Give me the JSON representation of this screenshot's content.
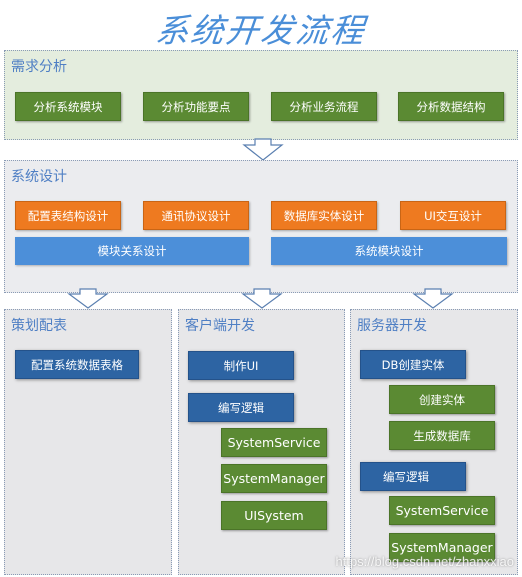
{
  "title": "系统开发流程",
  "requirements": {
    "label": "需求分析",
    "items": [
      "分析系统模块",
      "分析功能要点",
      "分析业务流程",
      "分析数据结构"
    ]
  },
  "design": {
    "label": "系统设计",
    "orange_items": [
      "配置表结构设计",
      "通讯协议设计",
      "数据库实体设计",
      "UI交互设计"
    ],
    "blue_items": [
      "模块关系设计",
      "系统模块设计"
    ]
  },
  "planning": {
    "label": "策划配表",
    "items": [
      "配置系统数据表格"
    ]
  },
  "client": {
    "label": "客户端开发",
    "steps": [
      "制作UI",
      "编写逻辑"
    ],
    "sub_items": [
      "SystemService",
      "SystemManager",
      "UISystem"
    ]
  },
  "server": {
    "label": "服务器开发",
    "db_step": "DB创建实体",
    "db_sub_items": [
      "创建实体",
      "生成数据库"
    ],
    "logic_step": "编写逻辑",
    "logic_sub_items": [
      "SystemService",
      "SystemManager"
    ]
  },
  "watermark": "https://blog.csdn.net/zhanxxiao",
  "colors": {
    "title": "#4a8ed8",
    "green_box": "#5b8a33",
    "orange_box": "#ee7a20",
    "light_blue_box": "#4c8fd9",
    "navy_box": "#2d64a3",
    "requirements_bg": "#e4edde",
    "design_bg": "#ebecef"
  }
}
